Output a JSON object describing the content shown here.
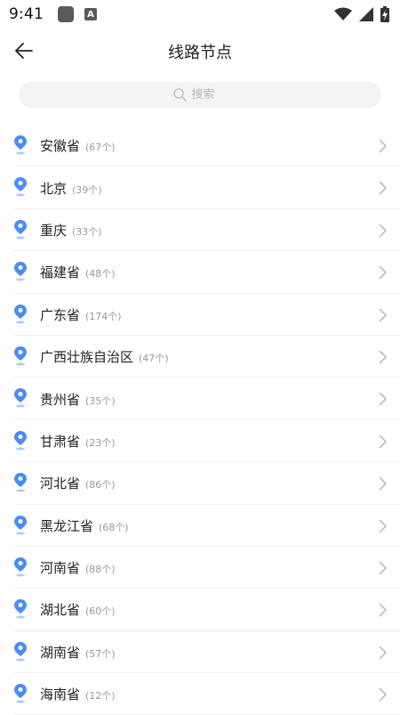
{
  "status_bar": {
    "time": "9:41",
    "a_icon_letter": "A"
  },
  "header": {
    "title": "线路节点"
  },
  "search": {
    "placeholder": "搜索"
  },
  "colors": {
    "accent": "#4a8cf7",
    "divider": "#f0f0f0",
    "search_bg": "#f4f4f4"
  },
  "regions": [
    {
      "name": "安徽省",
      "count": "(67个)"
    },
    {
      "name": "北京",
      "count": "(39个)"
    },
    {
      "name": "重庆",
      "count": "(33个)"
    },
    {
      "name": "福建省",
      "count": "(48个)"
    },
    {
      "name": "广东省",
      "count": "(174个)"
    },
    {
      "name": "广西壮族自治区",
      "count": "(47个)"
    },
    {
      "name": "贵州省",
      "count": "(35个)"
    },
    {
      "name": "甘肃省",
      "count": "(23个)"
    },
    {
      "name": "河北省",
      "count": "(86个)"
    },
    {
      "name": "黑龙江省",
      "count": "(68个)"
    },
    {
      "name": "河南省",
      "count": "(88个)"
    },
    {
      "name": "湖北省",
      "count": "(60个)"
    },
    {
      "name": "湖南省",
      "count": "(57个)"
    },
    {
      "name": "海南省",
      "count": "(12个)"
    }
  ]
}
